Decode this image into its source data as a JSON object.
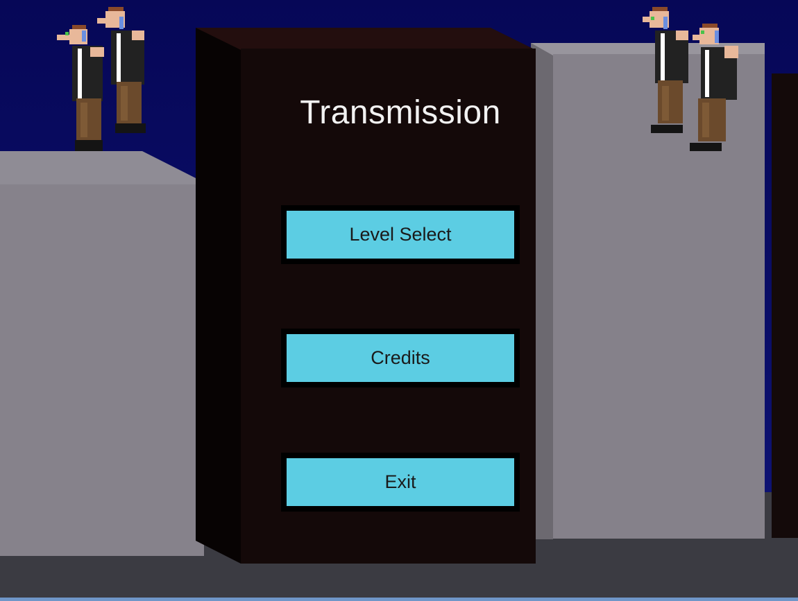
{
  "game": {
    "title": "Transmission",
    "menu": {
      "level_select": "Level Select",
      "credits": "Credits",
      "exit": "Exit"
    }
  },
  "colors": {
    "sky": "#07085c",
    "button_face": "#5ccde3",
    "button_border": "#000000",
    "tower": "#140909",
    "building": "#86828b",
    "floor": "#3b3b42"
  },
  "sprites": {
    "characters": [
      "character-sprite",
      "character-sprite",
      "character-sprite",
      "character-sprite"
    ]
  }
}
